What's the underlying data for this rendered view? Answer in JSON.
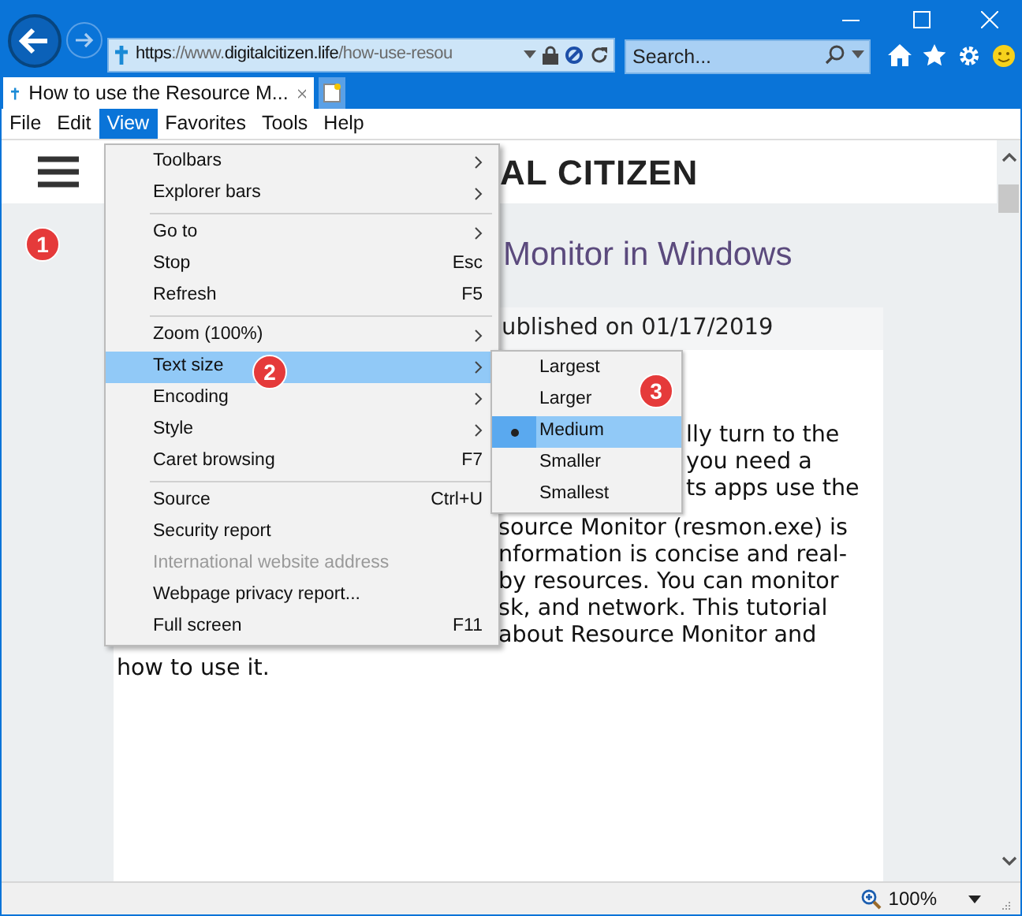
{
  "address_bar": {
    "url": [
      {
        "text": "https",
        "emphasis": true
      },
      {
        "text": "://www.",
        "emphasis": false
      },
      {
        "text": "digitalcitizen.life",
        "emphasis": true
      },
      {
        "text": "/how-use-resou",
        "emphasis": false
      }
    ]
  },
  "search": {
    "placeholder": "Search..."
  },
  "tabs": [
    {
      "title": "How to use the Resource M...",
      "selected": true
    }
  ],
  "menu_bar": [
    {
      "label": "File",
      "selected": false
    },
    {
      "label": "Edit",
      "selected": false
    },
    {
      "label": "View",
      "selected": true
    },
    {
      "label": "Favorites",
      "selected": false
    },
    {
      "label": "Tools",
      "selected": false
    },
    {
      "label": "Help",
      "selected": false
    }
  ],
  "view_menu": [
    {
      "kind": "item",
      "label": "Toolbars",
      "has_submenu": true,
      "disabled": false,
      "selected": false
    },
    {
      "kind": "item",
      "label": "Explorer bars",
      "has_submenu": true,
      "disabled": false,
      "selected": false
    },
    {
      "kind": "separator"
    },
    {
      "kind": "item",
      "label": "Go to",
      "has_submenu": true,
      "disabled": false,
      "selected": false
    },
    {
      "kind": "item",
      "label": "Stop",
      "shortcut": "Esc",
      "has_submenu": false,
      "disabled": false,
      "selected": false
    },
    {
      "kind": "item",
      "label": "Refresh",
      "shortcut": "F5",
      "has_submenu": false,
      "disabled": false,
      "selected": false
    },
    {
      "kind": "separator"
    },
    {
      "kind": "item",
      "label": "Zoom (100%)",
      "has_submenu": true,
      "disabled": false,
      "selected": false
    },
    {
      "kind": "item",
      "label": "Text size",
      "has_submenu": true,
      "disabled": false,
      "selected": true
    },
    {
      "kind": "item",
      "label": "Encoding",
      "has_submenu": true,
      "disabled": false,
      "selected": false
    },
    {
      "kind": "item",
      "label": "Style",
      "has_submenu": true,
      "disabled": false,
      "selected": false
    },
    {
      "kind": "item",
      "label": "Caret browsing",
      "shortcut": "F7",
      "has_submenu": false,
      "disabled": false,
      "selected": false
    },
    {
      "kind": "separator"
    },
    {
      "kind": "item",
      "label": "Source",
      "shortcut": "Ctrl+U",
      "has_submenu": false,
      "disabled": false,
      "selected": false
    },
    {
      "kind": "item",
      "label": "Security report",
      "has_submenu": false,
      "disabled": false,
      "selected": false
    },
    {
      "kind": "item",
      "label": "International website address",
      "has_submenu": false,
      "disabled": true,
      "selected": false
    },
    {
      "kind": "item",
      "label": "Webpage privacy report...",
      "has_submenu": false,
      "disabled": false,
      "selected": false
    },
    {
      "kind": "item",
      "label": "Full screen",
      "shortcut": "F11",
      "has_submenu": false,
      "disabled": false,
      "selected": false
    }
  ],
  "text_size_menu": [
    {
      "label": "Largest",
      "selected": false
    },
    {
      "label": "Larger",
      "selected": false
    },
    {
      "label": "Medium",
      "selected": true
    },
    {
      "label": "Smaller",
      "selected": false
    },
    {
      "label": "Smallest",
      "selected": false
    }
  ],
  "page": {
    "logo": "AL CITIZEN",
    "title": "Monitor in Windows",
    "published": "ublished on 01/17/2019",
    "article_lines": [
      {
        "text": "lly turn to the",
        "kind": "beside_submenu"
      },
      {
        "text": "you need a",
        "kind": "beside_submenu"
      },
      {
        "text": "ts apps use the",
        "kind": "beside_submenu"
      },
      {
        "text": "source Monitor (resmon.exe) is",
        "kind": "beside_menu"
      },
      {
        "text": "nformation is concise and real-",
        "kind": "beside_menu"
      },
      {
        "text": "by resources. You can monitor",
        "kind": "beside_menu"
      },
      {
        "text": "sk, and network. This tutorial",
        "kind": "beside_menu"
      },
      {
        "text": "about Resource Monitor and",
        "kind": "beside_menu"
      },
      {
        "text": "how to use it.",
        "kind": "full"
      }
    ]
  },
  "callouts": [
    "1",
    "2",
    "3"
  ],
  "status_bar": {
    "zoom": "100%"
  }
}
